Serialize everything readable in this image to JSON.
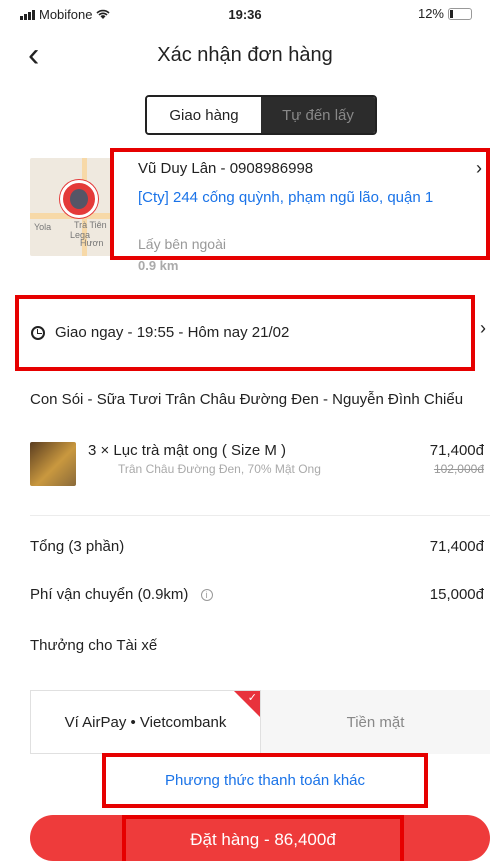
{
  "status_bar": {
    "carrier": "Mobifone",
    "time": "19:36",
    "battery": "12%"
  },
  "header": {
    "back_icon": "chevron-left-icon",
    "title": "Xác nhận đơn hàng"
  },
  "delivery_mode": {
    "options": [
      "Giao hàng",
      "Tự đến lấy"
    ],
    "selected": "Giao hàng"
  },
  "address": {
    "name_phone": "Vũ Duy Lân - 0908986998",
    "address_line": "[Cty] 244 cống quỳnh, phạm ngũ lão, quận 1",
    "note": "Lấy bên ngoài",
    "distance": "0.9 km",
    "map_labels": [
      "Yola",
      "Trà Tiên",
      "Lega",
      "Hươn"
    ]
  },
  "delivery_time": {
    "text": "Giao ngay - 19:55 - Hôm nay 21/02"
  },
  "store": {
    "name": "Con Sói - Sữa Tươi Trân Châu Đường Đen - Nguyễn Đình Chiểu"
  },
  "items": [
    {
      "quantity_name": "3 × Lục trà mật ong ( Size M )",
      "options": "Trân Châu Đường Đen, 70% Mật Ong",
      "price": "71,400đ",
      "old_price": "102,000đ"
    }
  ],
  "summary": {
    "subtotal_label": "Tổng (3 phần)",
    "subtotal_value": "71,400đ",
    "shipping_label": "Phí vận chuyển (0.9km)",
    "shipping_value": "15,000đ",
    "tip_label": "Thưởng cho Tài xế"
  },
  "payment": {
    "options": [
      "Ví AirPay • Vietcombank",
      "Tiền mặt"
    ],
    "selected": "Ví AirPay • Vietcombank",
    "other_label": "Phương thức thanh toán khác"
  },
  "order_button": {
    "label": "Đặt hàng - 86,400đ"
  },
  "colors": {
    "accent_red": "#ee3b3b",
    "highlight_red": "#e60000",
    "link_blue": "#1a73e8"
  }
}
